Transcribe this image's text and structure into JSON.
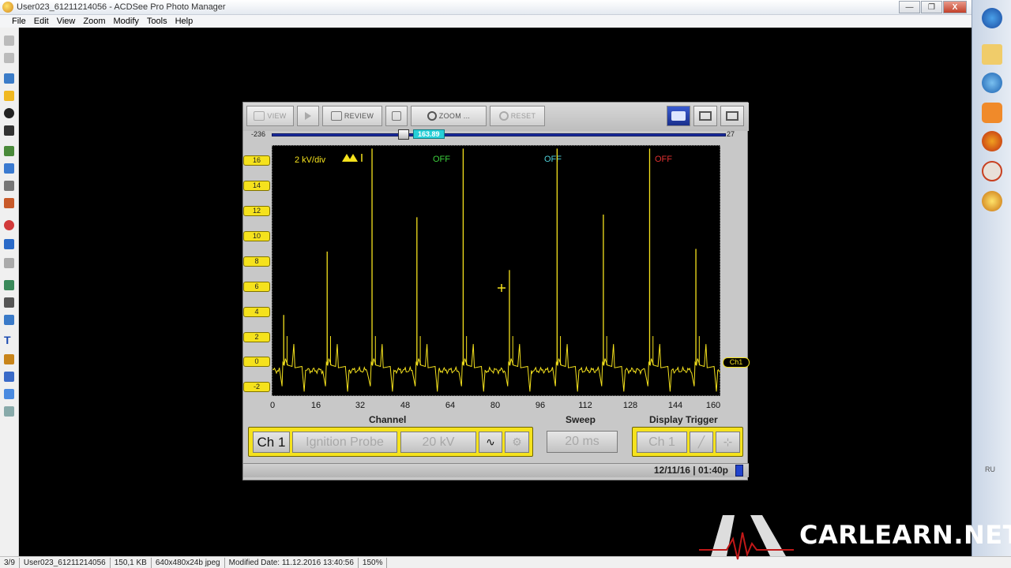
{
  "window": {
    "title": "User023_61211214056 - ACDSee Pro Photo Manager",
    "minimize_glyph": "—",
    "restore_glyph": "❐",
    "close_glyph": "X"
  },
  "menu": [
    "File",
    "Edit",
    "View",
    "Zoom",
    "Modify",
    "Tools",
    "Help"
  ],
  "scope": {
    "toolbar": {
      "view": "VIEW",
      "review": "REVIEW",
      "zoom": "ZOOM  ...",
      "reset": "RESET"
    },
    "slider": {
      "left": "-236",
      "value": "163.89",
      "right": "27",
      "position_fraction": 0.29
    },
    "plot_header": {
      "scale": "2 kV/div",
      "off_1": "OFF",
      "off_2": "OFF",
      "off_3": "OFF"
    },
    "ch1_marker": "Ch1",
    "section_titles": {
      "channel": "Channel",
      "sweep": "Sweep",
      "trigger": "Display Trigger"
    },
    "channel_panel": {
      "ch": "Ch 1",
      "probe": "Ignition Probe",
      "range": "20 kV"
    },
    "sweep": "20 ms",
    "trigger_panel": {
      "ch": "Ch 1"
    },
    "date": "12/11/16",
    "time": "01:40p"
  },
  "chart_data": {
    "type": "line",
    "title": "",
    "xlabel": "",
    "ylabel": "",
    "xlim": [
      0,
      160
    ],
    "ylim": [
      -2,
      17
    ],
    "x_ticks": [
      "0",
      "16",
      "32",
      "48",
      "64",
      "80",
      "96",
      "112",
      "128",
      "144",
      "160"
    ],
    "y_ticks": [
      "16",
      "14",
      "12",
      "10",
      "8",
      "6",
      "4",
      "2",
      "0",
      "-2"
    ],
    "series_color": "#f5e21d",
    "spikes": [
      {
        "x": 4,
        "y": 4.2
      },
      {
        "x": 19.5,
        "y": 9.0
      },
      {
        "x": 35.5,
        "y": 16.8
      },
      {
        "x": 51.5,
        "y": 11.6
      },
      {
        "x": 68,
        "y": 16.8
      },
      {
        "x": 84.5,
        "y": 7.6
      },
      {
        "x": 101.5,
        "y": 16.8
      },
      {
        "x": 118,
        "y": 11.8
      },
      {
        "x": 134.5,
        "y": 16.8
      },
      {
        "x": 151,
        "y": 9.2
      }
    ]
  },
  "status": [
    "3/9",
    "User023_61211214056",
    "150,1 KB",
    "640x480x24b jpeg",
    "Modified Date: 11.12.2016 13:40:56",
    "150%"
  ],
  "tray_lang": "RU",
  "logo": {
    "brand": "CARLEARN.NET"
  },
  "colors": {
    "scope_yellow": "#f5e21d",
    "slider_blue": "#1a2b9e",
    "cyan_value": "#27d0d8",
    "off_green": "#3ccf3c",
    "off_cyan": "#4fd0d8",
    "off_red": "#e03030"
  }
}
